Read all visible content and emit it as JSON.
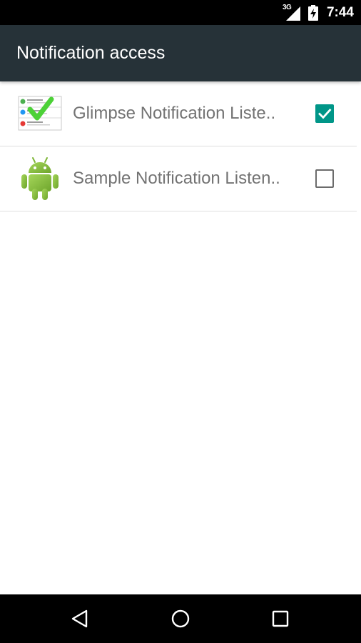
{
  "status_bar": {
    "network": "3G",
    "time": "7:44"
  },
  "app_bar": {
    "title": "Notification access"
  },
  "listeners": [
    {
      "label": "Glimpse Notification Liste..",
      "icon": "glimpse-app-icon",
      "checked": true
    },
    {
      "label": "Sample Notification Listen..",
      "icon": "android-robot-icon",
      "checked": false
    }
  ],
  "colors": {
    "toolbar": "#263238",
    "accent": "#009688",
    "android_green": "#8dc73f"
  },
  "nav_bar": {
    "buttons": [
      "back-icon",
      "home-icon",
      "recents-icon"
    ]
  }
}
